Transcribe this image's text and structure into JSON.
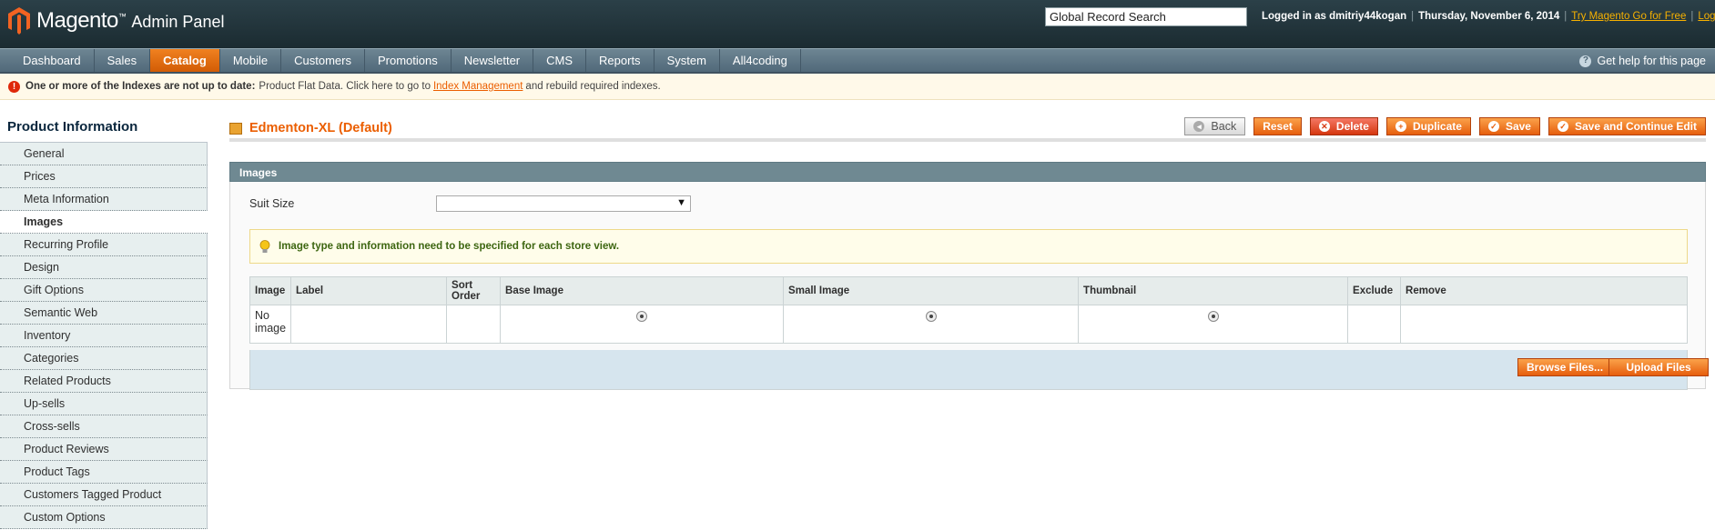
{
  "header": {
    "logo_text": "Magento",
    "logo_sub": "Admin Panel",
    "search_value": "Global Record Search",
    "logged_in": "Logged in as dmitriy44kogan",
    "date": "Thursday, November 6, 2014",
    "try_link": "Try Magento Go for Free",
    "logout": "Log Out"
  },
  "nav": {
    "items": [
      "Dashboard",
      "Sales",
      "Catalog",
      "Mobile",
      "Customers",
      "Promotions",
      "Newsletter",
      "CMS",
      "Reports",
      "System",
      "All4coding"
    ],
    "active": "Catalog",
    "help": "Get help for this page"
  },
  "notice": {
    "bold": "One or more of the Indexes are not up to date:",
    "text1": "Product Flat Data. Click here to go to",
    "link": "Index Management",
    "text2": "and rebuild required indexes."
  },
  "sidebar": {
    "title": "Product Information",
    "items": [
      "General",
      "Prices",
      "Meta Information",
      "Images",
      "Recurring Profile",
      "Design",
      "Gift Options",
      "Semantic Web",
      "Inventory",
      "Categories",
      "Related Products",
      "Up-sells",
      "Cross-sells",
      "Product Reviews",
      "Product Tags",
      "Customers Tagged Product",
      "Custom Options"
    ],
    "active": "Images"
  },
  "main": {
    "title": "Edmenton-XL (Default)",
    "buttons": {
      "back": "Back",
      "reset": "Reset",
      "delete": "Delete",
      "duplicate": "Duplicate",
      "save": "Save",
      "save_continue": "Save and Continue Edit"
    },
    "section_title": "Images",
    "field_label": "Suit Size",
    "select_value": "",
    "tip": "Image type and information need to be specified for each store view.",
    "table": {
      "headers": [
        "Image",
        "Label",
        "Sort Order",
        "Base Image",
        "Small Image",
        "Thumbnail",
        "Exclude",
        "Remove"
      ],
      "no_image": "No image"
    },
    "browse": "Browse Files...",
    "upload": "Upload Files"
  }
}
